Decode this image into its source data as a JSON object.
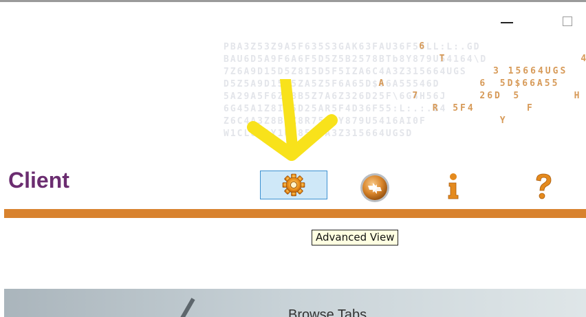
{
  "window": {
    "minimize_icon": "minimize-icon",
    "maximize_icon": "maximize-icon"
  },
  "header": {
    "matrix_rows": [
      "PBA3Z53Z9A5F635S3GAK63FAU36F55LL:L:.GD",
      "BAU6D5A9F6A6F5D5Z5B2578BTb8Y879U54164\\D",
      "7Z6A9D15D5Z8I5D5F5IZA6C4A3Z315664UGS",
      "D5Z5A9D15D5ZA5Z5F6A65D$66A55546D",
      "5A29A5F6Z58B5Z7A6Z326D25F\\6G4H56J",
      "6G45A1Z8IB5D25AR5F4D36F55:L:.:.G4",
      "Z6C4A3Z8B5Z8R75T6Y879U5416AI0F",
      "W1CL6A1Y1UZ85T5A3Z315664UGSD"
    ],
    "highlight_glyphs": [
      {
        "text": "6",
        "row": 0,
        "col": 29
      },
      {
        "text": "T",
        "row": 1,
        "col": 32
      },
      {
        "text": "4",
        "row": 1,
        "col": 53
      },
      {
        "text": "3 15664UGS",
        "row": 2,
        "col": 40
      },
      {
        "text": "5D$66A55",
        "row": 3,
        "col": 41
      },
      {
        "text": "6D",
        "row": 3,
        "col": 55
      },
      {
        "text": "A",
        "row": 3,
        "col": 23
      },
      {
        "text": "6",
        "row": 3,
        "col": 38
      },
      {
        "text": "7",
        "row": 4,
        "col": 28
      },
      {
        "text": "26D",
        "row": 4,
        "col": 38
      },
      {
        "text": "5",
        "row": 4,
        "col": 43
      },
      {
        "text": "H",
        "row": 4,
        "col": 52
      },
      {
        "text": "R",
        "row": 5,
        "col": 31
      },
      {
        "text": "5F4",
        "row": 5,
        "col": 34
      },
      {
        "text": "F",
        "row": 5,
        "col": 45
      },
      {
        "text": "Y",
        "row": 6,
        "col": 41
      }
    ],
    "app_name": "Client"
  },
  "toolbar": {
    "buttons": [
      {
        "name": "advanced-view",
        "icon": "gear-icon",
        "selected": true
      },
      {
        "name": "refresh",
        "icon": "refresh-icon",
        "selected": false
      },
      {
        "name": "info",
        "icon": "info-icon",
        "selected": false
      },
      {
        "name": "help",
        "icon": "help-icon",
        "selected": false
      }
    ],
    "tooltip": "Advanced View"
  },
  "annotation": {
    "arrow_icon": "yellow-arrow-icon"
  },
  "banner": {
    "text": "Browse Tabs"
  },
  "colors": {
    "brand_purple": "#6b2d70",
    "accent_orange": "#d8822e",
    "matrix_text": "#e3e5ea",
    "matrix_highlight": "#d79a58",
    "selection_border": "#3a8fd0",
    "selection_fill": "#cfe8f8",
    "tooltip_bg": "#ffffe1",
    "arrow_yellow": "#f8e21b"
  }
}
